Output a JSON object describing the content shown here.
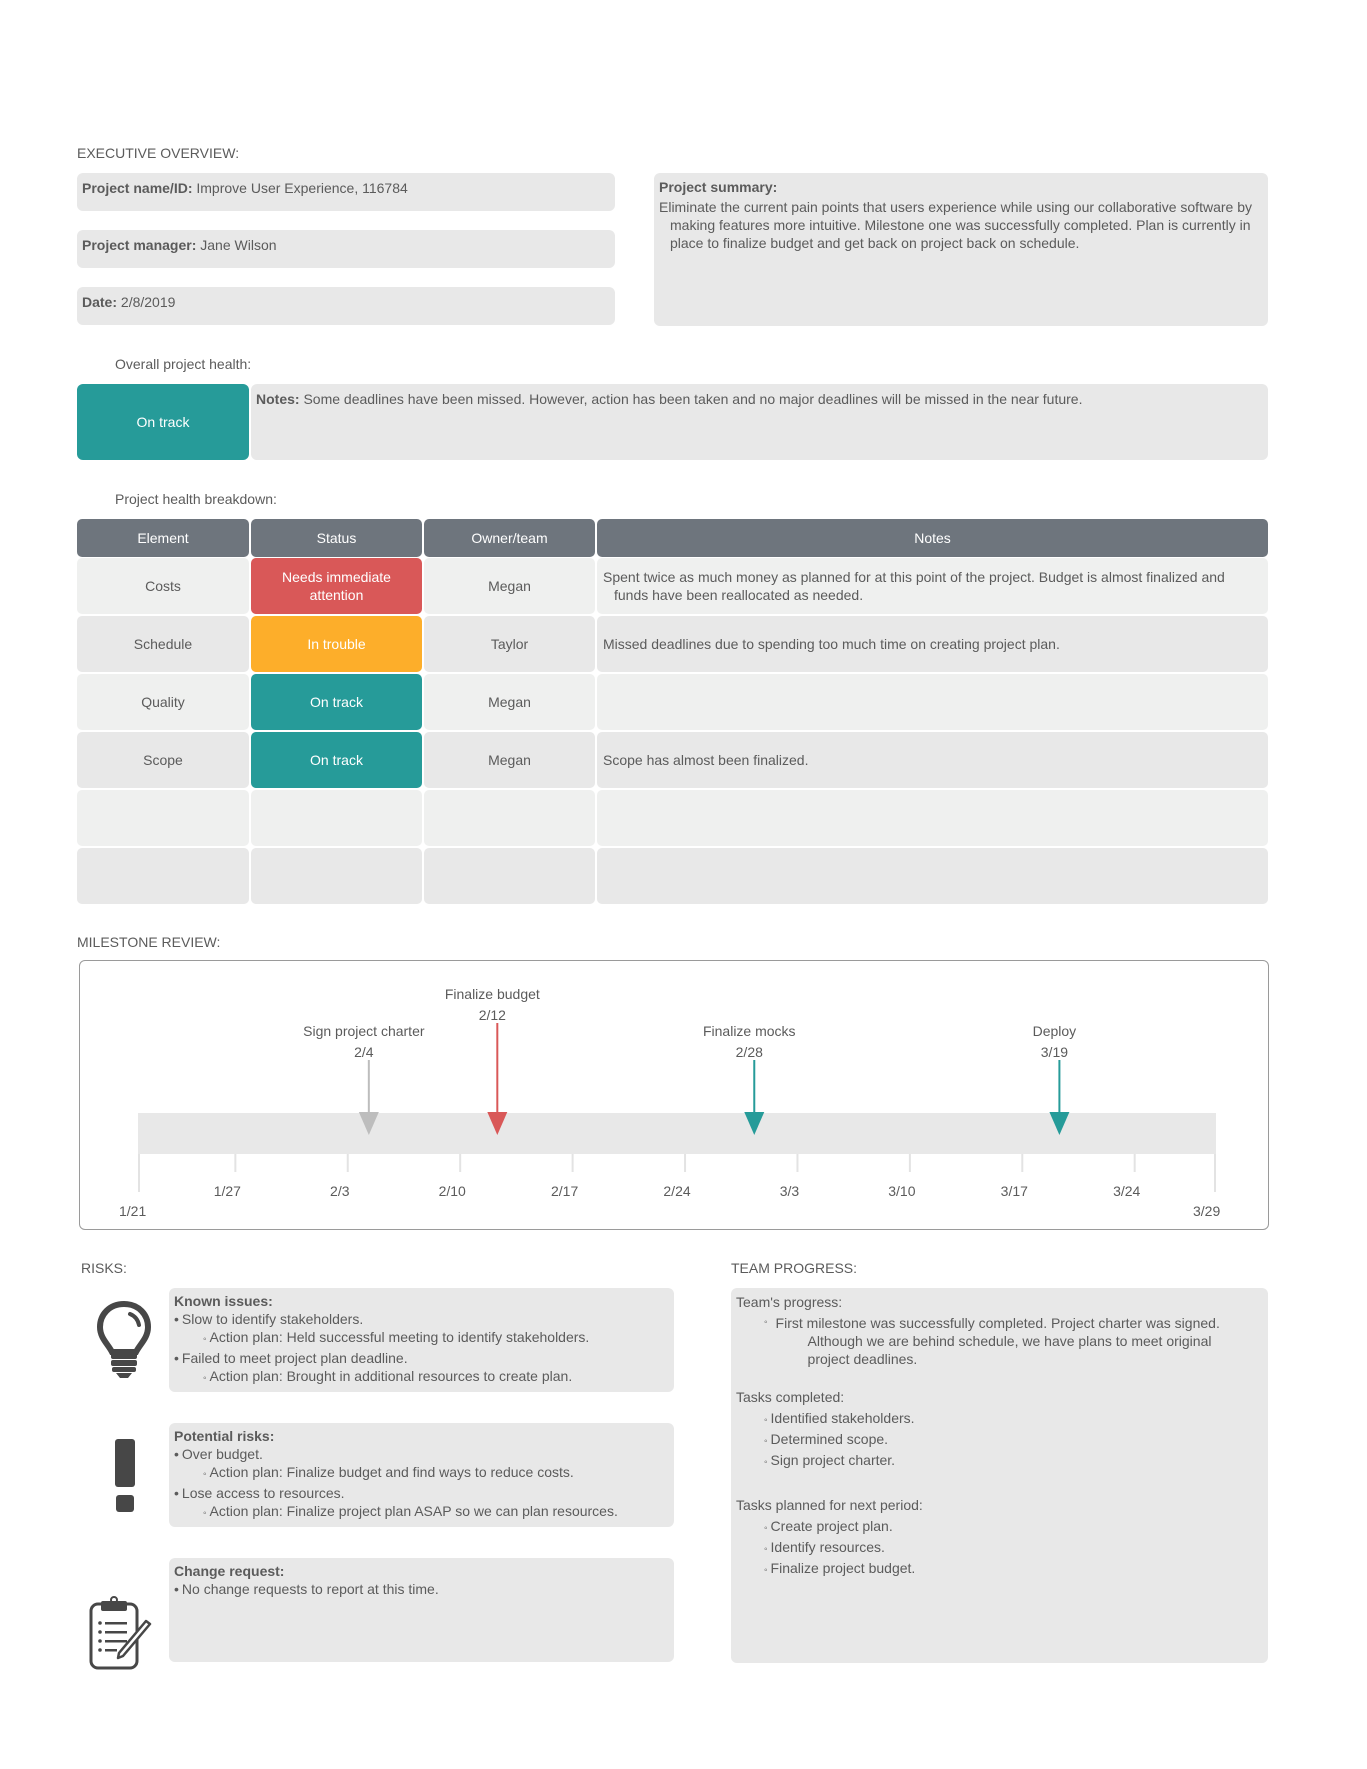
{
  "executive_overview": {
    "heading": "EXECUTIVE OVERVIEW:",
    "project_name_label": "Project name/ID:",
    "project_name_value": "Improve User Experience, 116784",
    "manager_label": "Project manager:",
    "manager_value": "Jane Wilson",
    "date_label": "Date:",
    "date_value": "2/8/2019",
    "summary_label": "Project summary:",
    "summary_text": "Eliminate the current pain points that users experience while using our collaborative software by making features more intuitive. Milestone one was successfully completed. Plan is currently in place to finalize budget and get back on project back on schedule."
  },
  "overall_health": {
    "heading": "Overall project health:",
    "status": "On track",
    "status_color": "#269b99",
    "notes_label": "Notes:",
    "notes_text": "Some deadlines have been missed. However, action has been taken and no major deadlines will be missed in the near future."
  },
  "health_breakdown": {
    "heading": "Project health breakdown:",
    "columns": [
      "Element",
      "Status",
      "Owner/team",
      "Notes"
    ],
    "rows": [
      {
        "element": "Costs",
        "status": "Needs immediate attention",
        "status_color": "#d95858",
        "owner": "Megan",
        "notes": "Spent twice as much money as planned for at this point of the project. Budget is almost finalized and funds have been reallocated as needed."
      },
      {
        "element": "Schedule",
        "status": "In trouble",
        "status_color": "#fdae2a",
        "owner": "Taylor",
        "notes": "Missed deadlines due to spending too much time on creating project plan."
      },
      {
        "element": "Quality",
        "status": "On track",
        "status_color": "#269b99",
        "owner": "Megan",
        "notes": ""
      },
      {
        "element": "Scope",
        "status": "On track",
        "status_color": "#269b99",
        "owner": "Megan",
        "notes": "Scope has almost been finalized."
      },
      {
        "element": "",
        "status": "",
        "status_color": "",
        "owner": "",
        "notes": ""
      },
      {
        "element": "",
        "status": "",
        "status_color": "",
        "owner": "",
        "notes": ""
      }
    ]
  },
  "milestone_review": {
    "heading": "MILESTONE REVIEW:",
    "start_label": "1/21",
    "end_label": "3/29",
    "tick_labels": [
      "1/27",
      "2/3",
      "2/10",
      "2/17",
      "2/24",
      "3/3",
      "3/10",
      "3/17",
      "3/24"
    ],
    "milestones": [
      {
        "name": "Sign project charter",
        "date": "2/4",
        "color": "#bdbdbd"
      },
      {
        "name": "Finalize budget",
        "date": "2/12",
        "color": "#d95858"
      },
      {
        "name": "Finalize mocks",
        "date": "2/28",
        "color": "#269b99"
      },
      {
        "name": "Deploy",
        "date": "3/19",
        "color": "#269b99"
      }
    ]
  },
  "risks": {
    "heading": "RISKS:",
    "known_issues": {
      "title": "Known issues:",
      "icon": "lightbulb-icon",
      "items": [
        {
          "text": "Slow to identify stakeholders.",
          "action": "Action plan: Held successful meeting to identify stakeholders."
        },
        {
          "text": "Failed to meet project plan deadline.",
          "action": "Action plan: Brought in additional resources to create plan."
        }
      ]
    },
    "potential_risks": {
      "title": "Potential risks:",
      "icon": "exclamation-icon",
      "items": [
        {
          "text": "Over budget.",
          "action": "Action plan: Finalize budget and find ways to reduce costs."
        },
        {
          "text": "Lose access to resources.",
          "action": "Action plan: Finalize project plan ASAP so we can plan resources."
        }
      ]
    },
    "change_request": {
      "title": "Change request:",
      "icon": "clipboard-icon",
      "items": [
        {
          "text": "No change requests to report at this time."
        }
      ]
    }
  },
  "team_progress": {
    "heading": "TEAM PROGRESS:",
    "progress_label": "Team's progress:",
    "progress_text": "First milestone was successfully completed. Project charter was signed. Although we are behind schedule, we have plans to meet original project deadlines.",
    "completed_label": "Tasks completed:",
    "completed": [
      "Identified stakeholders.",
      "Determined scope.",
      "Sign project charter."
    ],
    "planned_label": "Tasks planned for next period:",
    "planned": [
      "Create project plan.",
      "Identify resources.",
      "Finalize project budget."
    ]
  }
}
